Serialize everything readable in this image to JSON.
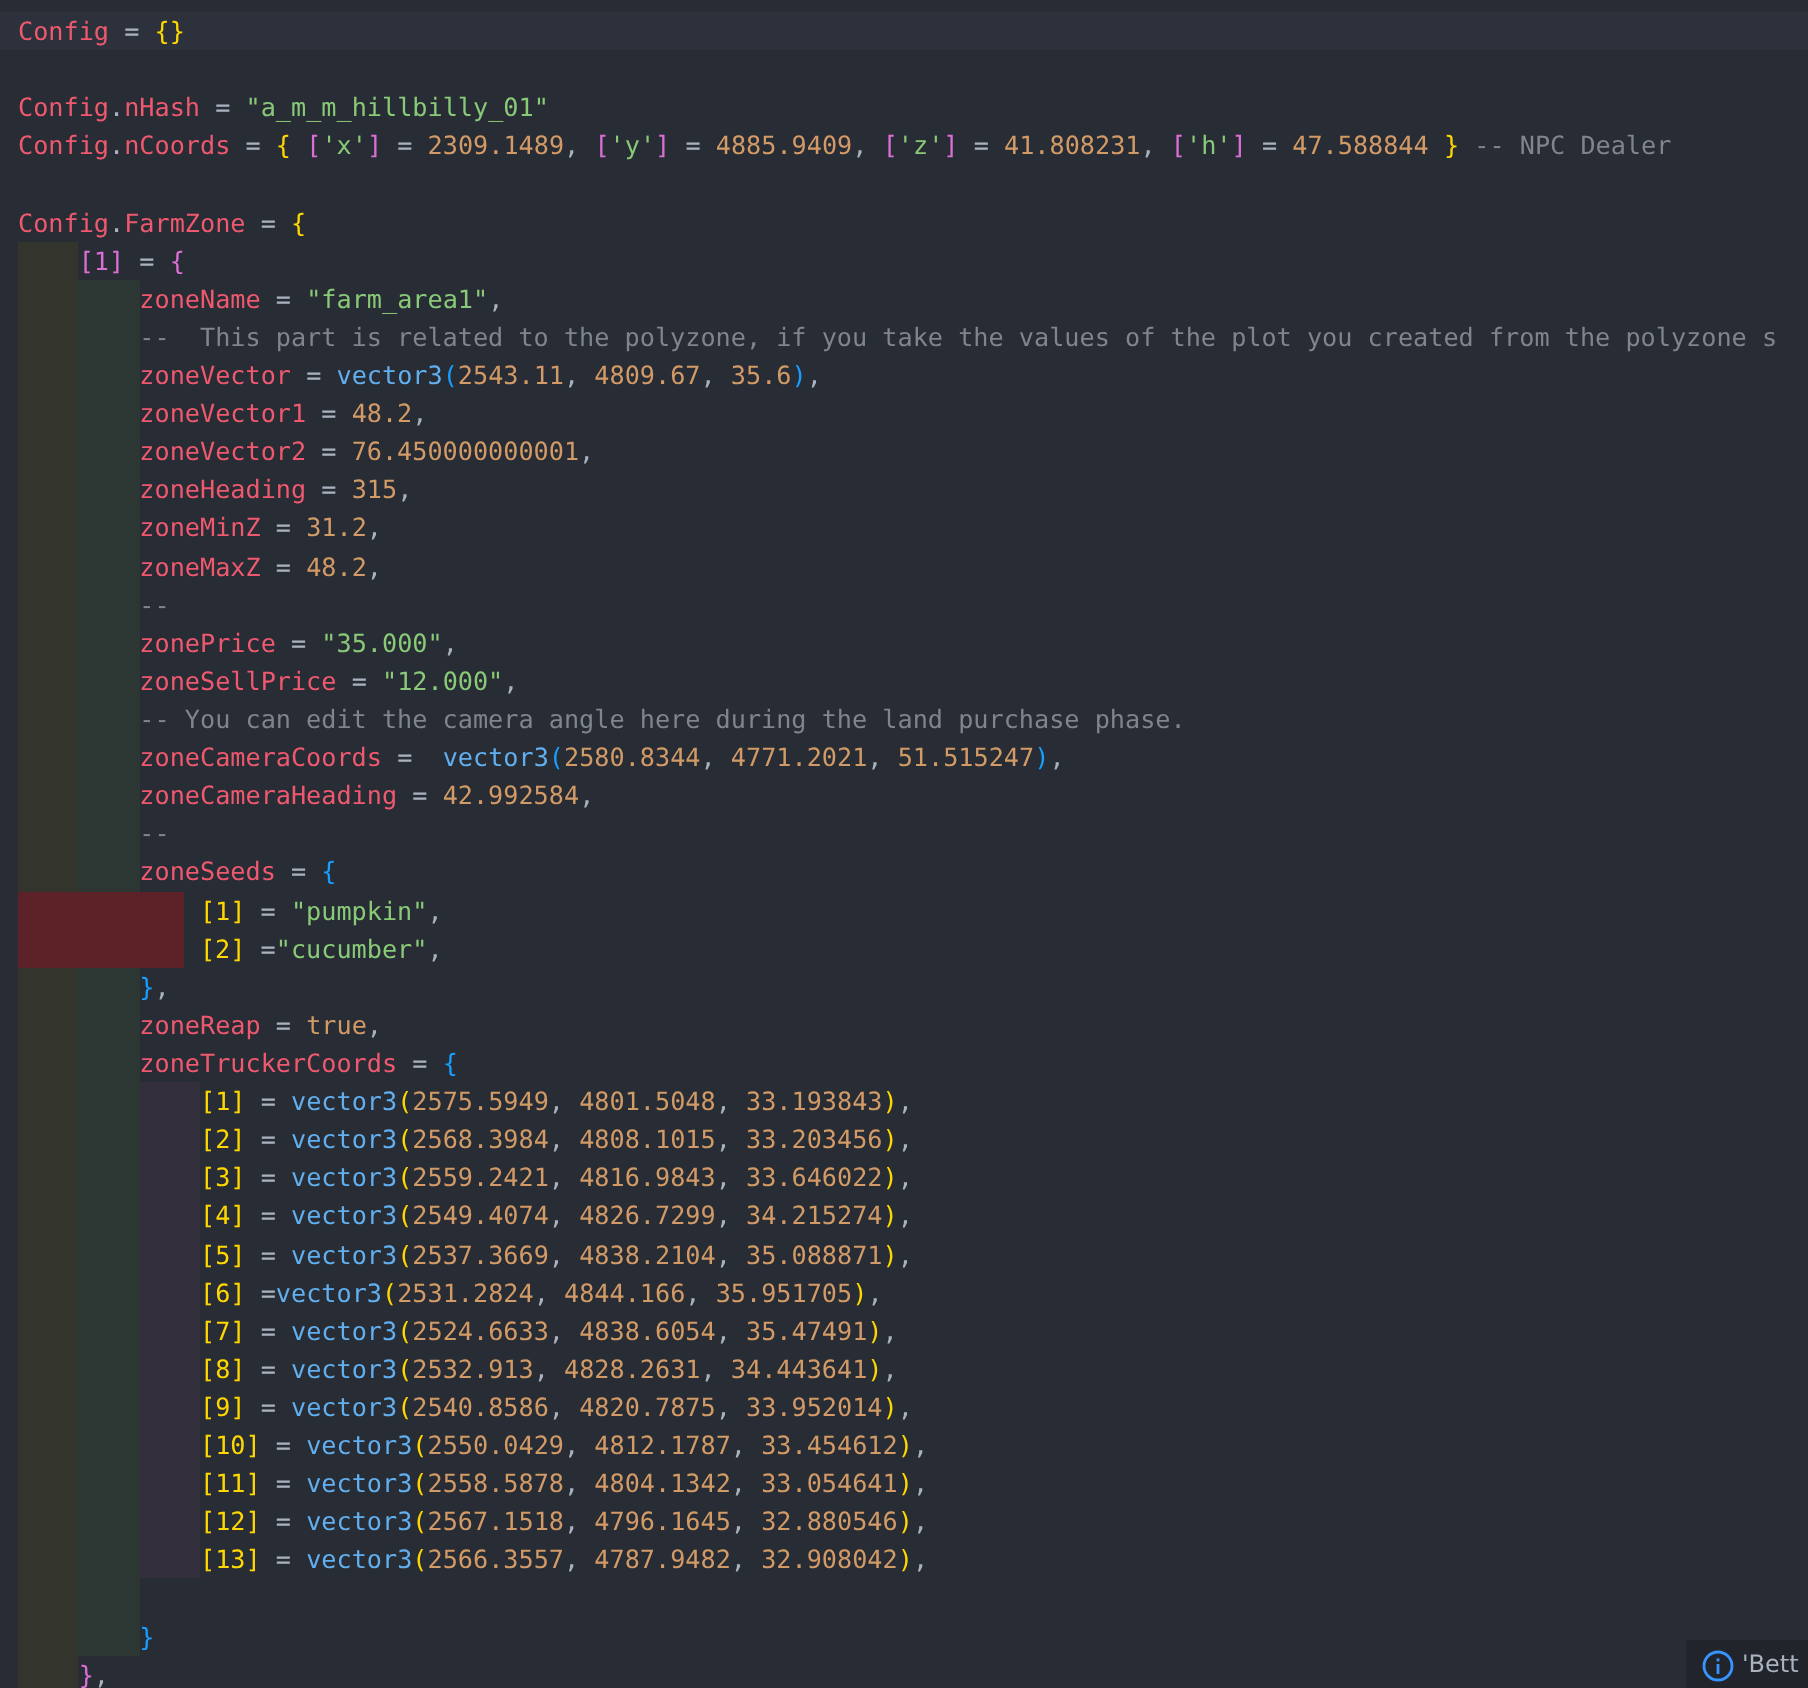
{
  "editor": {
    "lines": [
      {
        "kind": "code",
        "current": true,
        "tokens": [
          {
            "kind": "var",
            "text": "Config"
          },
          {
            "kind": "op",
            "text": " = "
          },
          {
            "kind": "b1",
            "text": "{}"
          }
        ]
      },
      {
        "kind": "blank"
      },
      {
        "kind": "code",
        "tokens": [
          {
            "kind": "var",
            "text": "Config"
          },
          {
            "kind": "op",
            "text": "."
          },
          {
            "kind": "var",
            "text": "nHash"
          },
          {
            "kind": "op",
            "text": " = "
          },
          {
            "kind": "str",
            "text": "\"a_m_m_hillbilly_01\""
          }
        ]
      },
      {
        "kind": "code",
        "tokens": [
          {
            "kind": "var",
            "text": "Config"
          },
          {
            "kind": "op",
            "text": "."
          },
          {
            "kind": "var",
            "text": "nCoords"
          },
          {
            "kind": "op",
            "text": " = "
          },
          {
            "kind": "b1",
            "text": "{"
          },
          {
            "kind": "b2",
            "text": " ["
          },
          {
            "kind": "str",
            "text": "'x'"
          },
          {
            "kind": "b2",
            "text": "]"
          },
          {
            "kind": "op",
            "text": " = "
          },
          {
            "kind": "num",
            "text": "2309.1489"
          },
          {
            "kind": "op",
            "text": ", "
          },
          {
            "kind": "b2",
            "text": "["
          },
          {
            "kind": "str",
            "text": "'y'"
          },
          {
            "kind": "b2",
            "text": "]"
          },
          {
            "kind": "op",
            "text": " = "
          },
          {
            "kind": "num",
            "text": "4885.9409"
          },
          {
            "kind": "op",
            "text": ", "
          },
          {
            "kind": "b2",
            "text": "["
          },
          {
            "kind": "str",
            "text": "'z'"
          },
          {
            "kind": "b2",
            "text": "]"
          },
          {
            "kind": "op",
            "text": " = "
          },
          {
            "kind": "num",
            "text": "41.808231"
          },
          {
            "kind": "op",
            "text": ", "
          },
          {
            "kind": "b2",
            "text": "["
          },
          {
            "kind": "str",
            "text": "'h'"
          },
          {
            "kind": "b2",
            "text": "]"
          },
          {
            "kind": "op",
            "text": " = "
          },
          {
            "kind": "num",
            "text": "47.588844"
          },
          {
            "kind": "b1",
            "text": " }"
          },
          {
            "kind": "cmt",
            "text": " -- NPC Dealer"
          }
        ]
      },
      {
        "kind": "blank"
      },
      {
        "kind": "code",
        "tokens": [
          {
            "kind": "var",
            "text": "Config"
          },
          {
            "kind": "op",
            "text": "."
          },
          {
            "kind": "var",
            "text": "FarmZone"
          },
          {
            "kind": "op",
            "text": " = "
          },
          {
            "kind": "b1",
            "text": "{"
          }
        ],
        "children": [
          {
            "kind": "code",
            "tokens": [
              {
                "kind": "b2",
                "text": "[1]"
              },
              {
                "kind": "op",
                "text": " = "
              },
              {
                "kind": "b2",
                "text": "{"
              }
            ],
            "children": [
              {
                "kind": "code",
                "tokens": [
                  {
                    "kind": "var",
                    "text": "zoneName"
                  },
                  {
                    "kind": "op",
                    "text": " = "
                  },
                  {
                    "kind": "str",
                    "text": "\"farm_area1\""
                  },
                  {
                    "kind": "op",
                    "text": ","
                  }
                ]
              },
              {
                "kind": "code",
                "tokens": [
                  {
                    "kind": "cmt",
                    "text": "--  This part is related to the polyzone, if you take the values of the plot you created from the polyzone s"
                  }
                ]
              },
              {
                "kind": "code",
                "tokens": [
                  {
                    "kind": "var",
                    "text": "zoneVector"
                  },
                  {
                    "kind": "op",
                    "text": " = "
                  },
                  {
                    "kind": "fn",
                    "text": "vector3"
                  },
                  {
                    "kind": "b3",
                    "text": "("
                  },
                  {
                    "kind": "num",
                    "text": "2543.11"
                  },
                  {
                    "kind": "op",
                    "text": ", "
                  },
                  {
                    "kind": "num",
                    "text": "4809.67"
                  },
                  {
                    "kind": "op",
                    "text": ", "
                  },
                  {
                    "kind": "num",
                    "text": "35.6"
                  },
                  {
                    "kind": "b3",
                    "text": ")"
                  },
                  {
                    "kind": "op",
                    "text": ","
                  }
                ]
              },
              {
                "kind": "code",
                "tokens": [
                  {
                    "kind": "var",
                    "text": "zoneVector1"
                  },
                  {
                    "kind": "op",
                    "text": " = "
                  },
                  {
                    "kind": "num",
                    "text": "48.2"
                  },
                  {
                    "kind": "op",
                    "text": ","
                  }
                ]
              },
              {
                "kind": "code",
                "tokens": [
                  {
                    "kind": "var",
                    "text": "zoneVector2"
                  },
                  {
                    "kind": "op",
                    "text": " = "
                  },
                  {
                    "kind": "num",
                    "text": "76.450000000001"
                  },
                  {
                    "kind": "op",
                    "text": ","
                  }
                ]
              },
              {
                "kind": "code",
                "tokens": [
                  {
                    "kind": "var",
                    "text": "zoneHeading"
                  },
                  {
                    "kind": "op",
                    "text": " = "
                  },
                  {
                    "kind": "num",
                    "text": "315"
                  },
                  {
                    "kind": "op",
                    "text": ","
                  }
                ]
              },
              {
                "kind": "code",
                "tokens": [
                  {
                    "kind": "var",
                    "text": "zoneMinZ"
                  },
                  {
                    "kind": "op",
                    "text": " = "
                  },
                  {
                    "kind": "num",
                    "text": "31.2"
                  },
                  {
                    "kind": "op",
                    "text": ","
                  }
                ]
              },
              {
                "kind": "code",
                "tokens": [
                  {
                    "kind": "var",
                    "text": "zoneMaxZ"
                  },
                  {
                    "kind": "op",
                    "text": " = "
                  },
                  {
                    "kind": "num",
                    "text": "48.2"
                  },
                  {
                    "kind": "op",
                    "text": ","
                  }
                ]
              },
              {
                "kind": "code",
                "tokens": [
                  {
                    "kind": "cmt",
                    "text": "--"
                  }
                ]
              },
              {
                "kind": "code",
                "tokens": [
                  {
                    "kind": "var",
                    "text": "zonePrice"
                  },
                  {
                    "kind": "op",
                    "text": " = "
                  },
                  {
                    "kind": "str",
                    "text": "\"35.000\""
                  },
                  {
                    "kind": "op",
                    "text": ","
                  }
                ]
              },
              {
                "kind": "code",
                "tokens": [
                  {
                    "kind": "var",
                    "text": "zoneSellPrice"
                  },
                  {
                    "kind": "op",
                    "text": " = "
                  },
                  {
                    "kind": "str",
                    "text": "\"12.000\""
                  },
                  {
                    "kind": "op",
                    "text": ","
                  }
                ]
              },
              {
                "kind": "code",
                "tokens": [
                  {
                    "kind": "cmt",
                    "text": "-- You can edit the camera angle here during the land purchase phase."
                  }
                ]
              },
              {
                "kind": "code",
                "tokens": [
                  {
                    "kind": "var",
                    "text": "zoneCameraCoords"
                  },
                  {
                    "kind": "op",
                    "text": " =  "
                  },
                  {
                    "kind": "fn",
                    "text": "vector3"
                  },
                  {
                    "kind": "b3",
                    "text": "("
                  },
                  {
                    "kind": "num",
                    "text": "2580.8344"
                  },
                  {
                    "kind": "op",
                    "text": ", "
                  },
                  {
                    "kind": "num",
                    "text": "4771.2021"
                  },
                  {
                    "kind": "op",
                    "text": ", "
                  },
                  {
                    "kind": "num",
                    "text": "51.515247"
                  },
                  {
                    "kind": "b3",
                    "text": ")"
                  },
                  {
                    "kind": "op",
                    "text": ","
                  }
                ]
              },
              {
                "kind": "code",
                "tokens": [
                  {
                    "kind": "var",
                    "text": "zoneCameraHeading"
                  },
                  {
                    "kind": "op",
                    "text": " = "
                  },
                  {
                    "kind": "num",
                    "text": "42.992584"
                  },
                  {
                    "kind": "op",
                    "text": ","
                  }
                ]
              },
              {
                "kind": "code",
                "tokens": [
                  {
                    "kind": "cmt",
                    "text": "--"
                  }
                ]
              },
              {
                "kind": "code",
                "tokens": [
                  {
                    "kind": "var",
                    "text": "zoneSeeds"
                  },
                  {
                    "kind": "op",
                    "text": " = "
                  },
                  {
                    "kind": "b3",
                    "text": "{"
                  }
                ],
                "children": [
                  {
                    "kind": "code",
                    "indent_error": true,
                    "tokens": [
                      {
                        "kind": "b1",
                        "text": "[1]"
                      },
                      {
                        "kind": "op",
                        "text": " = "
                      },
                      {
                        "kind": "str",
                        "text": "\"pumpkin\""
                      },
                      {
                        "kind": "op",
                        "text": ","
                      }
                    ]
                  },
                  {
                    "kind": "code",
                    "indent_error": true,
                    "tokens": [
                      {
                        "kind": "b1",
                        "text": "[2]"
                      },
                      {
                        "kind": "op",
                        "text": " ="
                      },
                      {
                        "kind": "str",
                        "text": "\"cucumber\""
                      },
                      {
                        "kind": "op",
                        "text": ","
                      }
                    ]
                  }
                ]
              },
              {
                "kind": "code",
                "tokens": [
                  {
                    "kind": "b3",
                    "text": "}"
                  },
                  {
                    "kind": "op",
                    "text": ","
                  }
                ]
              },
              {
                "kind": "code",
                "tokens": [
                  {
                    "kind": "var",
                    "text": "zoneReap"
                  },
                  {
                    "kind": "op",
                    "text": " = "
                  },
                  {
                    "kind": "bool",
                    "text": "true"
                  },
                  {
                    "kind": "op",
                    "text": ","
                  }
                ]
              },
              {
                "kind": "code",
                "tokens": [
                  {
                    "kind": "var",
                    "text": "zoneTruckerCoords"
                  },
                  {
                    "kind": "op",
                    "text": " = "
                  },
                  {
                    "kind": "b3",
                    "text": "{"
                  }
                ],
                "children": [
                  {
                    "kind": "code",
                    "tokens": [
                      {
                        "kind": "b1",
                        "text": "[1]"
                      },
                      {
                        "kind": "op",
                        "text": " = "
                      },
                      {
                        "kind": "fn",
                        "text": "vector3"
                      },
                      {
                        "kind": "b1",
                        "text": "("
                      },
                      {
                        "kind": "num",
                        "text": "2575.5949"
                      },
                      {
                        "kind": "op",
                        "text": ", "
                      },
                      {
                        "kind": "num",
                        "text": "4801.5048"
                      },
                      {
                        "kind": "op",
                        "text": ", "
                      },
                      {
                        "kind": "num",
                        "text": "33.193843"
                      },
                      {
                        "kind": "b1",
                        "text": ")"
                      },
                      {
                        "kind": "op",
                        "text": ","
                      }
                    ]
                  },
                  {
                    "kind": "code",
                    "tokens": [
                      {
                        "kind": "b1",
                        "text": "[2]"
                      },
                      {
                        "kind": "op",
                        "text": " = "
                      },
                      {
                        "kind": "fn",
                        "text": "vector3"
                      },
                      {
                        "kind": "b1",
                        "text": "("
                      },
                      {
                        "kind": "num",
                        "text": "2568.3984"
                      },
                      {
                        "kind": "op",
                        "text": ", "
                      },
                      {
                        "kind": "num",
                        "text": "4808.1015"
                      },
                      {
                        "kind": "op",
                        "text": ", "
                      },
                      {
                        "kind": "num",
                        "text": "33.203456"
                      },
                      {
                        "kind": "b1",
                        "text": ")"
                      },
                      {
                        "kind": "op",
                        "text": ","
                      }
                    ]
                  },
                  {
                    "kind": "code",
                    "tokens": [
                      {
                        "kind": "b1",
                        "text": "[3]"
                      },
                      {
                        "kind": "op",
                        "text": " = "
                      },
                      {
                        "kind": "fn",
                        "text": "vector3"
                      },
                      {
                        "kind": "b1",
                        "text": "("
                      },
                      {
                        "kind": "num",
                        "text": "2559.2421"
                      },
                      {
                        "kind": "op",
                        "text": ", "
                      },
                      {
                        "kind": "num",
                        "text": "4816.9843"
                      },
                      {
                        "kind": "op",
                        "text": ", "
                      },
                      {
                        "kind": "num",
                        "text": "33.646022"
                      },
                      {
                        "kind": "b1",
                        "text": ")"
                      },
                      {
                        "kind": "op",
                        "text": ","
                      }
                    ]
                  },
                  {
                    "kind": "code",
                    "tokens": [
                      {
                        "kind": "b1",
                        "text": "[4]"
                      },
                      {
                        "kind": "op",
                        "text": " = "
                      },
                      {
                        "kind": "fn",
                        "text": "vector3"
                      },
                      {
                        "kind": "b1",
                        "text": "("
                      },
                      {
                        "kind": "num",
                        "text": "2549.4074"
                      },
                      {
                        "kind": "op",
                        "text": ", "
                      },
                      {
                        "kind": "num",
                        "text": "4826.7299"
                      },
                      {
                        "kind": "op",
                        "text": ", "
                      },
                      {
                        "kind": "num",
                        "text": "34.215274"
                      },
                      {
                        "kind": "b1",
                        "text": ")"
                      },
                      {
                        "kind": "op",
                        "text": ","
                      }
                    ]
                  },
                  {
                    "kind": "code",
                    "tokens": [
                      {
                        "kind": "b1",
                        "text": "[5]"
                      },
                      {
                        "kind": "op",
                        "text": " = "
                      },
                      {
                        "kind": "fn",
                        "text": "vector3"
                      },
                      {
                        "kind": "b1",
                        "text": "("
                      },
                      {
                        "kind": "num",
                        "text": "2537.3669"
                      },
                      {
                        "kind": "op",
                        "text": ", "
                      },
                      {
                        "kind": "num",
                        "text": "4838.2104"
                      },
                      {
                        "kind": "op",
                        "text": ", "
                      },
                      {
                        "kind": "num",
                        "text": "35.088871"
                      },
                      {
                        "kind": "b1",
                        "text": ")"
                      },
                      {
                        "kind": "op",
                        "text": ","
                      }
                    ]
                  },
                  {
                    "kind": "code",
                    "tokens": [
                      {
                        "kind": "b1",
                        "text": "[6]"
                      },
                      {
                        "kind": "op",
                        "text": " ="
                      },
                      {
                        "kind": "fn",
                        "text": "vector3"
                      },
                      {
                        "kind": "b1",
                        "text": "("
                      },
                      {
                        "kind": "num",
                        "text": "2531.2824"
                      },
                      {
                        "kind": "op",
                        "text": ", "
                      },
                      {
                        "kind": "num",
                        "text": "4844.166"
                      },
                      {
                        "kind": "op",
                        "text": ", "
                      },
                      {
                        "kind": "num",
                        "text": "35.951705"
                      },
                      {
                        "kind": "b1",
                        "text": ")"
                      },
                      {
                        "kind": "op",
                        "text": ","
                      }
                    ]
                  },
                  {
                    "kind": "code",
                    "tokens": [
                      {
                        "kind": "b1",
                        "text": "[7]"
                      },
                      {
                        "kind": "op",
                        "text": " = "
                      },
                      {
                        "kind": "fn",
                        "text": "vector3"
                      },
                      {
                        "kind": "b1",
                        "text": "("
                      },
                      {
                        "kind": "num",
                        "text": "2524.6633"
                      },
                      {
                        "kind": "op",
                        "text": ", "
                      },
                      {
                        "kind": "num",
                        "text": "4838.6054"
                      },
                      {
                        "kind": "op",
                        "text": ", "
                      },
                      {
                        "kind": "num",
                        "text": "35.47491"
                      },
                      {
                        "kind": "b1",
                        "text": ")"
                      },
                      {
                        "kind": "op",
                        "text": ","
                      }
                    ]
                  },
                  {
                    "kind": "code",
                    "tokens": [
                      {
                        "kind": "b1",
                        "text": "[8]"
                      },
                      {
                        "kind": "op",
                        "text": " = "
                      },
                      {
                        "kind": "fn",
                        "text": "vector3"
                      },
                      {
                        "kind": "b1",
                        "text": "("
                      },
                      {
                        "kind": "num",
                        "text": "2532.913"
                      },
                      {
                        "kind": "op",
                        "text": ", "
                      },
                      {
                        "kind": "num",
                        "text": "4828.2631"
                      },
                      {
                        "kind": "op",
                        "text": ", "
                      },
                      {
                        "kind": "num",
                        "text": "34.443641"
                      },
                      {
                        "kind": "b1",
                        "text": ")"
                      },
                      {
                        "kind": "op",
                        "text": ","
                      }
                    ]
                  },
                  {
                    "kind": "code",
                    "tokens": [
                      {
                        "kind": "b1",
                        "text": "[9]"
                      },
                      {
                        "kind": "op",
                        "text": " = "
                      },
                      {
                        "kind": "fn",
                        "text": "vector3"
                      },
                      {
                        "kind": "b1",
                        "text": "("
                      },
                      {
                        "kind": "num",
                        "text": "2540.8586"
                      },
                      {
                        "kind": "op",
                        "text": ", "
                      },
                      {
                        "kind": "num",
                        "text": "4820.7875"
                      },
                      {
                        "kind": "op",
                        "text": ", "
                      },
                      {
                        "kind": "num",
                        "text": "33.952014"
                      },
                      {
                        "kind": "b1",
                        "text": ")"
                      },
                      {
                        "kind": "op",
                        "text": ","
                      }
                    ]
                  },
                  {
                    "kind": "code",
                    "tokens": [
                      {
                        "kind": "b1",
                        "text": "[10]"
                      },
                      {
                        "kind": "op",
                        "text": " = "
                      },
                      {
                        "kind": "fn",
                        "text": "vector3"
                      },
                      {
                        "kind": "b1",
                        "text": "("
                      },
                      {
                        "kind": "num",
                        "text": "2550.0429"
                      },
                      {
                        "kind": "op",
                        "text": ", "
                      },
                      {
                        "kind": "num",
                        "text": "4812.1787"
                      },
                      {
                        "kind": "op",
                        "text": ", "
                      },
                      {
                        "kind": "num",
                        "text": "33.454612"
                      },
                      {
                        "kind": "b1",
                        "text": ")"
                      },
                      {
                        "kind": "op",
                        "text": ","
                      }
                    ]
                  },
                  {
                    "kind": "code",
                    "tokens": [
                      {
                        "kind": "b1",
                        "text": "[11]"
                      },
                      {
                        "kind": "op",
                        "text": " = "
                      },
                      {
                        "kind": "fn",
                        "text": "vector3"
                      },
                      {
                        "kind": "b1",
                        "text": "("
                      },
                      {
                        "kind": "num",
                        "text": "2558.5878"
                      },
                      {
                        "kind": "op",
                        "text": ", "
                      },
                      {
                        "kind": "num",
                        "text": "4804.1342"
                      },
                      {
                        "kind": "op",
                        "text": ", "
                      },
                      {
                        "kind": "num",
                        "text": "33.054641"
                      },
                      {
                        "kind": "b1",
                        "text": ")"
                      },
                      {
                        "kind": "op",
                        "text": ","
                      }
                    ]
                  },
                  {
                    "kind": "code",
                    "tokens": [
                      {
                        "kind": "b1",
                        "text": "[12]"
                      },
                      {
                        "kind": "op",
                        "text": " = "
                      },
                      {
                        "kind": "fn",
                        "text": "vector3"
                      },
                      {
                        "kind": "b1",
                        "text": "("
                      },
                      {
                        "kind": "num",
                        "text": "2567.1518"
                      },
                      {
                        "kind": "op",
                        "text": ", "
                      },
                      {
                        "kind": "num",
                        "text": "4796.1645"
                      },
                      {
                        "kind": "op",
                        "text": ", "
                      },
                      {
                        "kind": "num",
                        "text": "32.880546"
                      },
                      {
                        "kind": "b1",
                        "text": ")"
                      },
                      {
                        "kind": "op",
                        "text": ","
                      }
                    ]
                  },
                  {
                    "kind": "code",
                    "tokens": [
                      {
                        "kind": "b1",
                        "text": "[13]"
                      },
                      {
                        "kind": "op",
                        "text": " = "
                      },
                      {
                        "kind": "fn",
                        "text": "vector3"
                      },
                      {
                        "kind": "b1",
                        "text": "("
                      },
                      {
                        "kind": "num",
                        "text": "2566.3557"
                      },
                      {
                        "kind": "op",
                        "text": ", "
                      },
                      {
                        "kind": "num",
                        "text": "4787.9482"
                      },
                      {
                        "kind": "op",
                        "text": ", "
                      },
                      {
                        "kind": "num",
                        "text": "32.908042"
                      },
                      {
                        "kind": "b1",
                        "text": ")"
                      },
                      {
                        "kind": "op",
                        "text": ","
                      }
                    ]
                  }
                ]
              },
              {
                "kind": "blank"
              },
              {
                "kind": "code",
                "tokens": [
                  {
                    "kind": "b3",
                    "text": "}"
                  }
                ]
              }
            ]
          },
          {
            "kind": "code",
            "tokens": [
              {
                "kind": "b2",
                "text": "}"
              },
              {
                "kind": "op",
                "text": ","
              }
            ]
          }
        ]
      }
    ]
  },
  "notification": {
    "text": "'Bett"
  }
}
